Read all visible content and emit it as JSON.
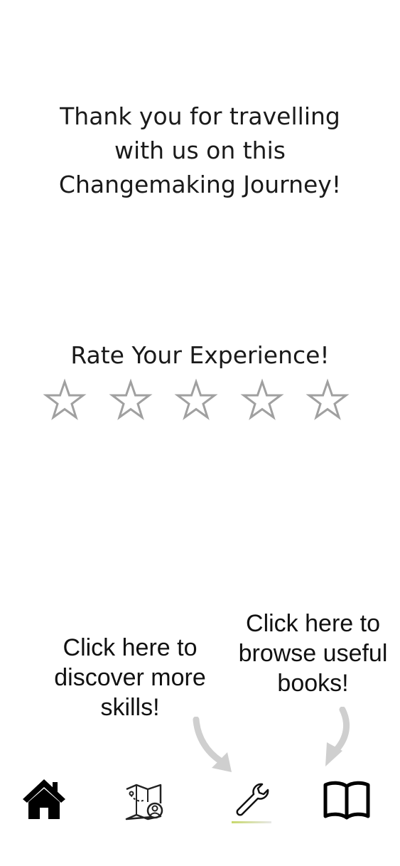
{
  "thanks": {
    "line1": "Thank you for travelling",
    "line2": "with us on this",
    "line3": "Changemaking Journey!"
  },
  "rating": {
    "title": "Rate Your Experience!",
    "value": 0,
    "max": 5,
    "star_color": "#a0a0a0"
  },
  "hints": {
    "skills": {
      "line1": "Click here to",
      "line2": "discover more",
      "line3": "skills!"
    },
    "books": {
      "line1": "Click here to",
      "line2": "browse useful",
      "line3": "books!"
    },
    "arrow_color": "#cfcfcf"
  },
  "nav": {
    "items": [
      {
        "icon": "home-icon"
      },
      {
        "icon": "map-icon"
      },
      {
        "icon": "wrench-icon"
      },
      {
        "icon": "book-icon"
      }
    ],
    "icon_color": "#000000",
    "active_indicator_color": "#c7d86b"
  }
}
